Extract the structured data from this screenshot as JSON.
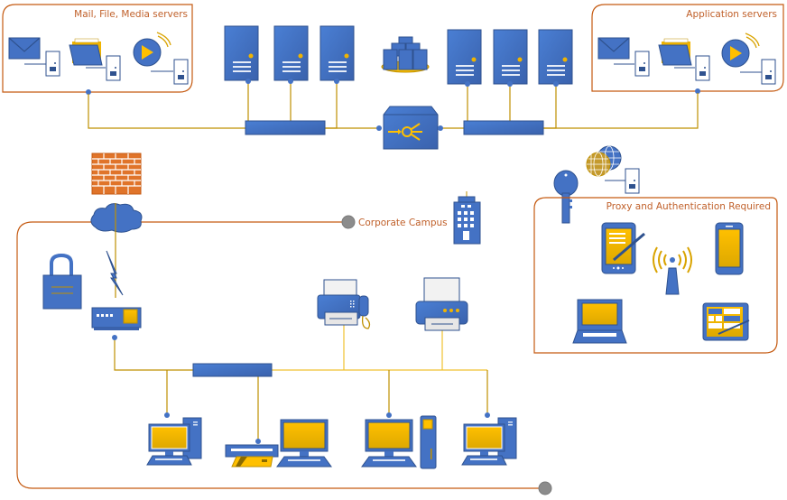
{
  "colors": {
    "blue": "#4472c4",
    "blue_dark": "#2f528f",
    "gold": "#f0b400",
    "gold_line": "#bf9000",
    "orange": "#c55a11",
    "gray": "#8c8c8c",
    "brick": "#e0742a"
  },
  "groups": {
    "mail_file_media": {
      "label": "Mail, File, Media servers",
      "items": [
        "mail-server",
        "file-server",
        "media-server"
      ]
    },
    "application": {
      "label": "Application servers",
      "items": [
        "mail-server",
        "file-server",
        "media-server"
      ]
    },
    "proxy": {
      "label": "Proxy and Authentication Required",
      "items": [
        "pda",
        "wireless-access-point",
        "smartphone",
        "laptop",
        "tablet"
      ]
    },
    "campus": {
      "label": "Corporate Campus"
    }
  },
  "nodes": {
    "server_farm": "server-farm",
    "load_balancer": "load-balancer",
    "firewall": "firewall",
    "cloud": "internet-cloud",
    "key": "authentication-key",
    "web_server": "web-server",
    "building": "corporate-building",
    "lock": "security-lock",
    "router": "router",
    "fax": "fax-machine",
    "printer": "printer",
    "workstations": [
      "pc",
      "pc-with-card-reader",
      "pc-tower",
      "pc"
    ]
  }
}
